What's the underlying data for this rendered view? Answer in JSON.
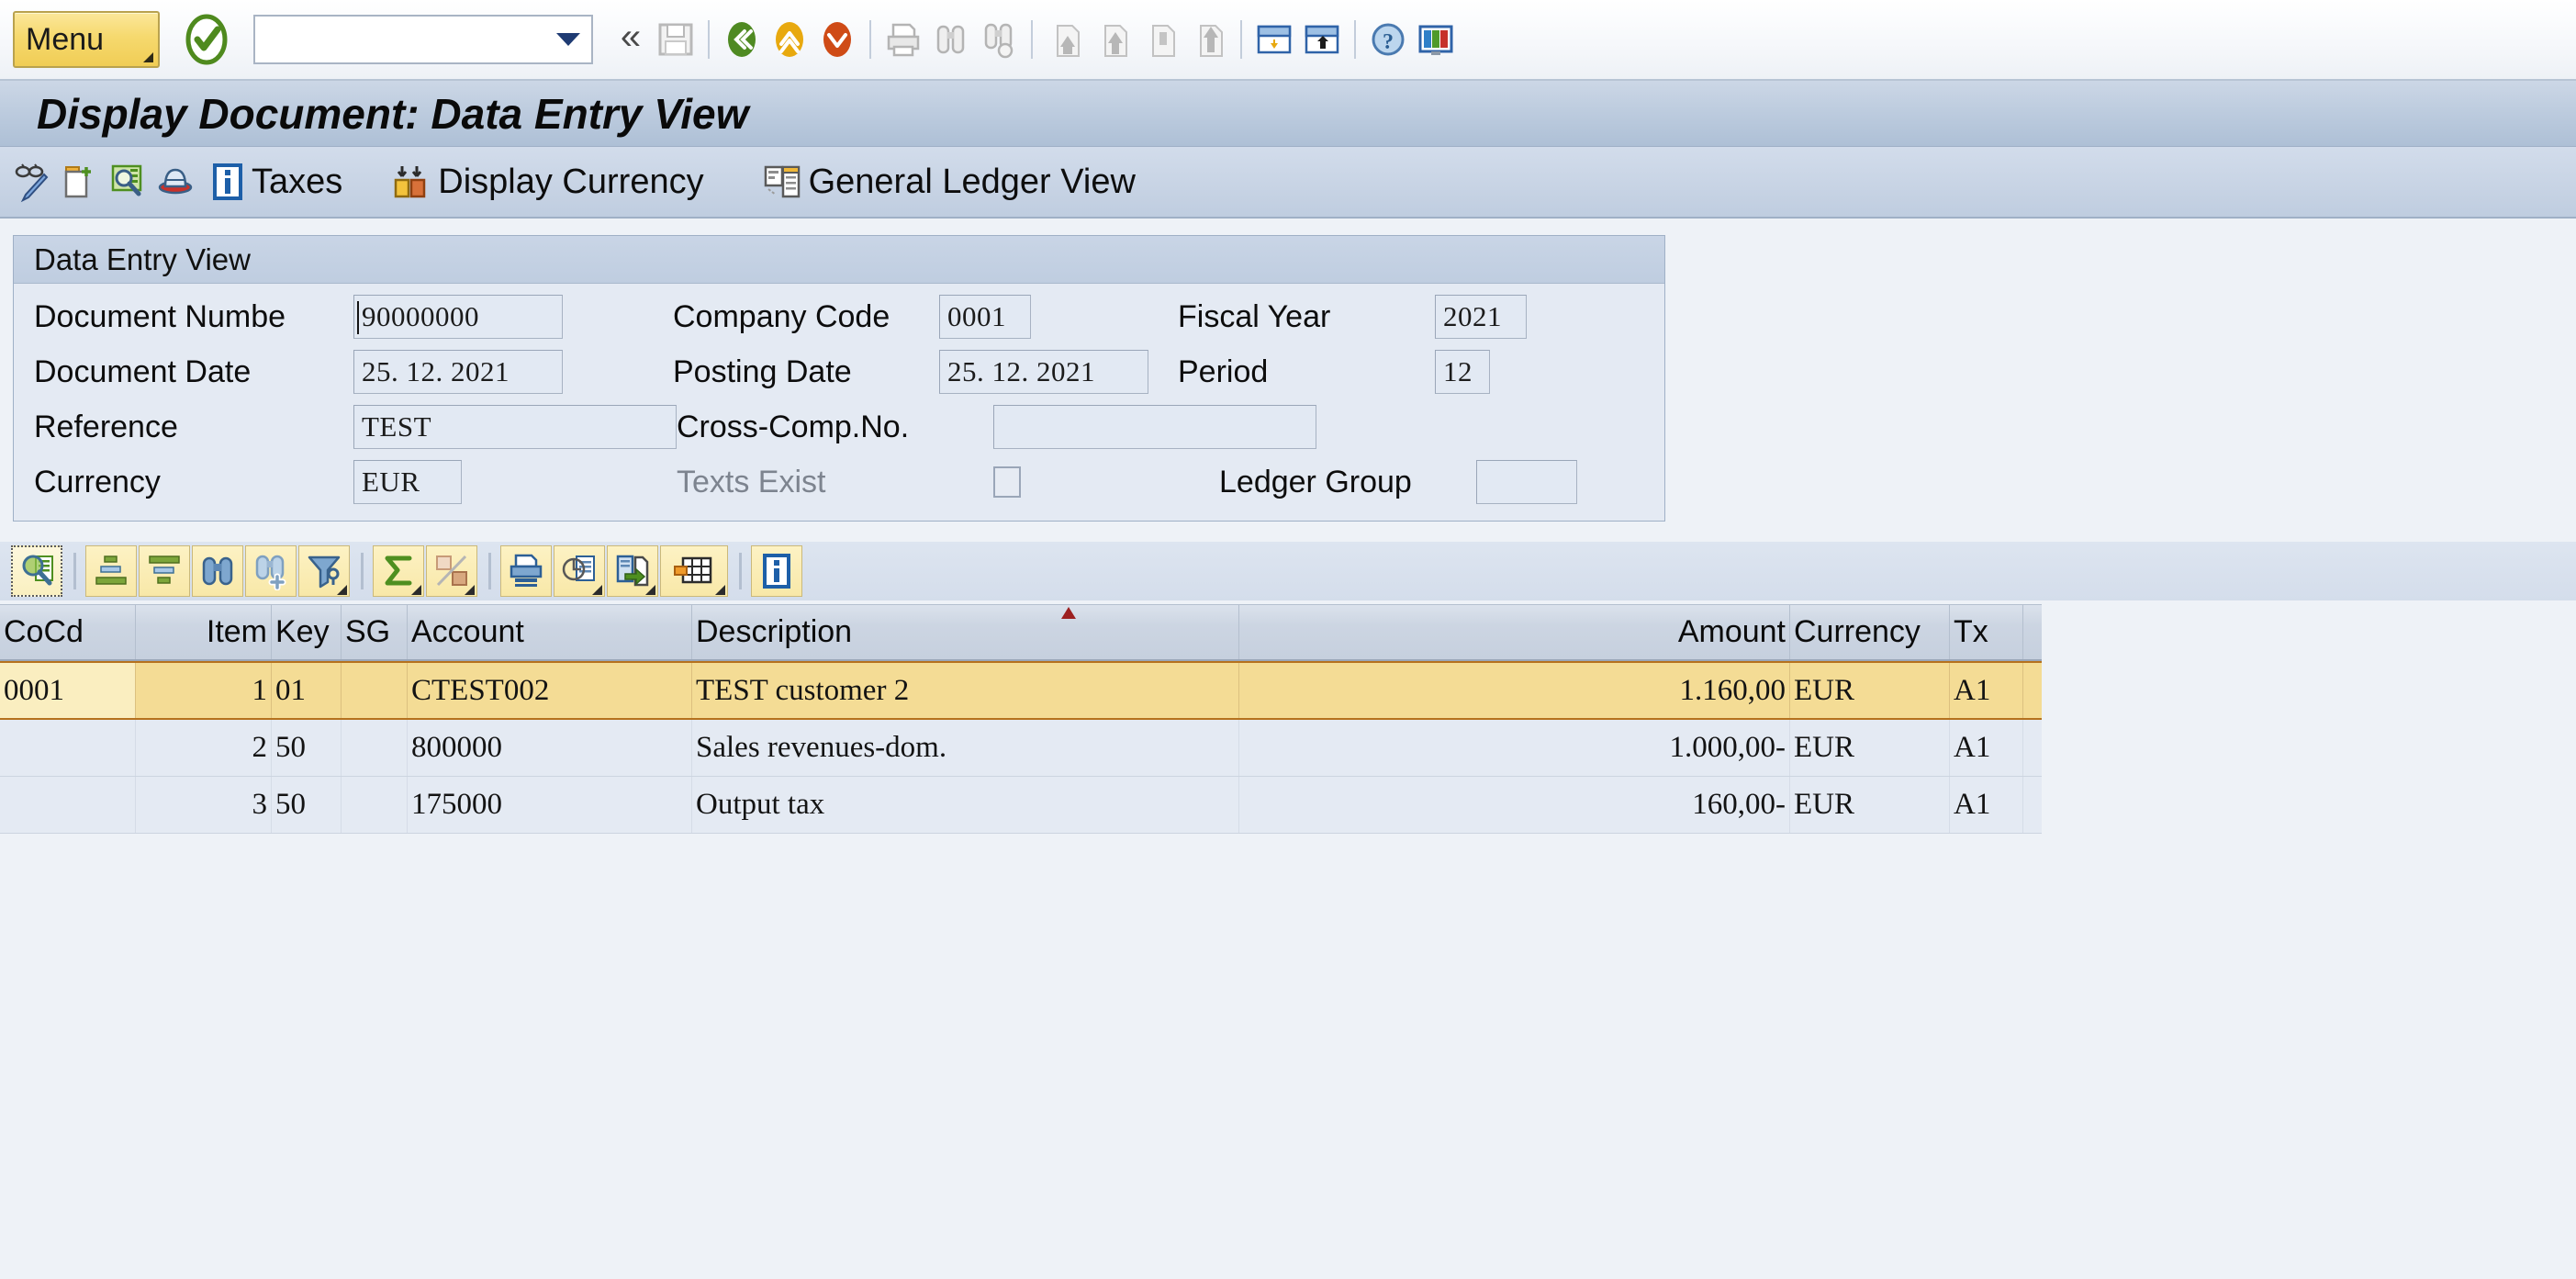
{
  "system_toolbar": {
    "menu_label": "Menu",
    "command_field_value": "",
    "command_field_placeholder": "",
    "icons": [
      {
        "name": "enter-check-icon",
        "title": "Continue (Enter)"
      },
      {
        "name": "back-chevrons-icon",
        "title": "Back"
      },
      {
        "name": "save-icon",
        "title": "Save"
      },
      {
        "name": "back-green-icon",
        "title": "Back (F3)"
      },
      {
        "name": "exit-yellow-icon",
        "title": "Exit"
      },
      {
        "name": "cancel-red-icon",
        "title": "Cancel (F12)"
      },
      {
        "name": "print-icon",
        "title": "Print"
      },
      {
        "name": "find-icon",
        "title": "Find"
      },
      {
        "name": "find-next-icon",
        "title": "Find Next"
      },
      {
        "name": "first-page-icon",
        "title": "First Page"
      },
      {
        "name": "previous-page-icon",
        "title": "Previous Page"
      },
      {
        "name": "next-page-icon",
        "title": "Next Page"
      },
      {
        "name": "last-page-icon",
        "title": "Last Page"
      },
      {
        "name": "create-session-icon",
        "title": "Create New Session"
      },
      {
        "name": "create-shortcut-icon",
        "title": "Create Shortcut"
      },
      {
        "name": "help-icon",
        "title": "Help"
      },
      {
        "name": "customize-layout-icon",
        "title": "Customize Local Layout"
      }
    ]
  },
  "title_bar": {
    "title": "Display Document: Data Entry View"
  },
  "app_toolbar": {
    "icon_buttons": [
      {
        "name": "display-change-icon",
        "title": "Display/Change"
      },
      {
        "name": "other-document-icon",
        "title": "Other Document"
      },
      {
        "name": "document-overview-icon",
        "title": "Document Overview"
      },
      {
        "name": "park-document-icon",
        "title": "Park Document"
      }
    ],
    "buttons": [
      {
        "name": "taxes-button",
        "label": "Taxes",
        "icon": "info-blue-icon"
      },
      {
        "name": "display-currency-button",
        "label": "Display Currency",
        "icon": "currency-columns-icon"
      },
      {
        "name": "general-ledger-view-button",
        "label": "General Ledger View",
        "icon": "ledger-table-icon"
      }
    ]
  },
  "data_entry_group": {
    "header": "Data Entry View",
    "fields": {
      "document_number": {
        "label": "Document Numbe",
        "value": "90000000"
      },
      "company_code": {
        "label": "Company Code",
        "value": "0001"
      },
      "fiscal_year": {
        "label": "Fiscal Year",
        "value": "2021"
      },
      "document_date": {
        "label": "Document Date",
        "value": "25. 12. 2021"
      },
      "posting_date": {
        "label": "Posting Date",
        "value": "25. 12. 2021"
      },
      "period": {
        "label": "Period",
        "value": "12"
      },
      "reference": {
        "label": "Reference",
        "value": "TEST"
      },
      "cross_comp_no": {
        "label": "Cross-Comp.No.",
        "value": ""
      },
      "currency": {
        "label": "Currency",
        "value": "EUR"
      },
      "texts_exist": {
        "label": "Texts Exist",
        "checked": false,
        "disabled": true
      },
      "ledger_group": {
        "label": "Ledger Group",
        "value": ""
      }
    }
  },
  "alv_toolbar": {
    "buttons": [
      {
        "name": "details-icon",
        "title": "Details"
      },
      {
        "name": "sort-ascending-icon",
        "title": "Sort in Ascending Order"
      },
      {
        "name": "sort-descending-icon",
        "title": "Sort in Descending Order"
      },
      {
        "name": "find-icon",
        "title": "Find"
      },
      {
        "name": "find-next-icon",
        "title": "Find Next"
      },
      {
        "name": "filter-icon",
        "title": "Set Filter"
      },
      {
        "name": "total-sum-icon",
        "title": "Total"
      },
      {
        "name": "subtotal-icon",
        "title": "Subtotals"
      },
      {
        "name": "print-preview-icon",
        "title": "Print Preview"
      },
      {
        "name": "change-layout-icon",
        "title": "Select Layout"
      },
      {
        "name": "export-icon",
        "title": "Export"
      },
      {
        "name": "grid-layout-icon",
        "title": "Choose Layout"
      },
      {
        "name": "info-icon",
        "title": "Information"
      }
    ]
  },
  "grid": {
    "columns": [
      {
        "key": "cocd",
        "label": "CoCd",
        "align": "left",
        "sorted": true
      },
      {
        "key": "item",
        "label": "Item",
        "align": "right"
      },
      {
        "key": "key",
        "label": "Key",
        "align": "left"
      },
      {
        "key": "sg",
        "label": "SG",
        "align": "left"
      },
      {
        "key": "account",
        "label": "Account",
        "align": "left"
      },
      {
        "key": "description",
        "label": "Description",
        "align": "left"
      },
      {
        "key": "amount",
        "label": "Amount",
        "align": "right"
      },
      {
        "key": "currency",
        "label": "Currency",
        "align": "left"
      },
      {
        "key": "tx",
        "label": "Tx",
        "align": "left"
      }
    ],
    "rows": [
      {
        "selected": true,
        "cocd": "0001",
        "item": "1",
        "key": "01",
        "sg": "",
        "account": "CTEST002",
        "description": "TEST customer 2",
        "amount": "1.160,00",
        "currency": "EUR",
        "tx": "A1"
      },
      {
        "selected": false,
        "cocd": "",
        "item": "2",
        "key": "50",
        "sg": "",
        "account": "800000",
        "description": "Sales revenues-dom.",
        "amount": "1.000,00-",
        "currency": "EUR",
        "tx": "A1"
      },
      {
        "selected": false,
        "cocd": "",
        "item": "3",
        "key": "50",
        "sg": "",
        "account": "175000",
        "description": "Output tax",
        "amount": "160,00-",
        "currency": "EUR",
        "tx": "A1"
      }
    ]
  },
  "colors": {
    "selection_yellow": "#f4dc95",
    "lead_cell_yellow": "#faeec0",
    "selection_border": "#b5711d",
    "header_blue": "#c6d0de",
    "panel_bg": "#e4eaf3",
    "title_gradient_top": "#ccd7e6",
    "menu_yellow": "#f6d96e"
  }
}
